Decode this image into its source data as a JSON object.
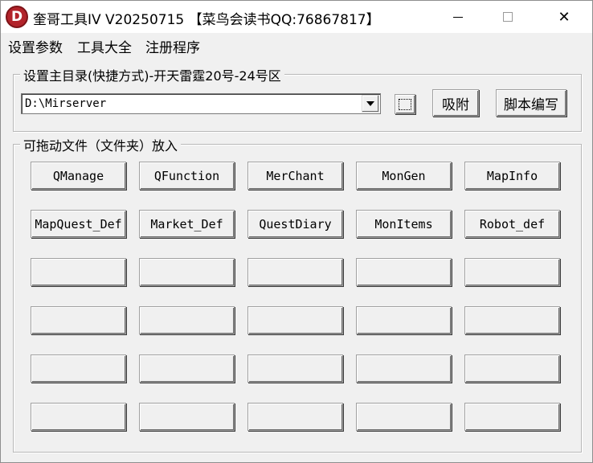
{
  "window": {
    "icon_letter": "D",
    "title": "奎哥工具IV V20250715 【菜鸟会读书QQ:76867817】",
    "close_glyph": "✕"
  },
  "menu": {
    "items": [
      "设置参数",
      "工具大全",
      "注册程序"
    ]
  },
  "dir_group": {
    "legend": "设置主目录(快捷方式)-开天雷霆20号-24号区",
    "path_value": "D:\\Mirserver",
    "attach_label": "吸附",
    "script_edit_label": "脚本编写"
  },
  "files_group": {
    "legend": "可拖动文件（文件夹）放入",
    "buttons": [
      "QManage",
      "QFunction",
      "MerChant",
      "MonGen",
      "MapInfo",
      "MapQuest_Def",
      "Market_Def",
      "QuestDiary",
      "MonItems",
      "Robot_def",
      "",
      "",
      "",
      "",
      "",
      "",
      "",
      "",
      "",
      "",
      "",
      "",
      "",
      "",
      "",
      "",
      "",
      "",
      "",
      ""
    ]
  }
}
